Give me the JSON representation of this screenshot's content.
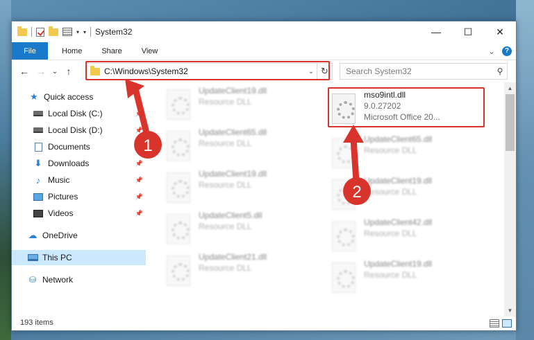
{
  "window": {
    "title": "System32",
    "controls": {
      "minimize": "—",
      "maximize": "☐",
      "close": "✕"
    }
  },
  "ribbon": {
    "tabs": [
      "File",
      "Home",
      "Share",
      "View"
    ],
    "expand_glyph": "⌄",
    "help_glyph": "?"
  },
  "nav": {
    "back": "←",
    "forward": "→",
    "recent": "⌄",
    "up": "↑",
    "address": "C:\\Windows\\System32",
    "address_dropdown": "⌄",
    "refresh": "↻",
    "search_placeholder": "Search System32",
    "search_glyph": "⚲"
  },
  "sidebar": {
    "items": [
      {
        "label": "Quick access",
        "icon": "star-icon"
      },
      {
        "label": "Local Disk (C:)",
        "icon": "drive-icon",
        "pinned": true
      },
      {
        "label": "Local Disk (D:)",
        "icon": "drive-icon",
        "pinned": true
      },
      {
        "label": "Documents",
        "icon": "documents-icon",
        "pinned": true
      },
      {
        "label": "Downloads",
        "icon": "downloads-icon",
        "pinned": true
      },
      {
        "label": "Music",
        "icon": "music-icon",
        "pinned": true
      },
      {
        "label": "Pictures",
        "icon": "pictures-icon",
        "pinned": true
      },
      {
        "label": "Videos",
        "icon": "videos-icon",
        "pinned": true
      },
      {
        "label": "OneDrive",
        "icon": "onedrive-icon"
      },
      {
        "label": "This PC",
        "icon": "this-pc-icon",
        "selected": true
      },
      {
        "label": "Network",
        "icon": "network-icon"
      }
    ],
    "pin_glyph": "📌"
  },
  "files": {
    "highlighted": {
      "name": "mso9intl.dll",
      "version": "9.0.27202",
      "description": "Microsoft Office 20..."
    },
    "left_column": [
      {
        "name": "UpdateClient19.dll",
        "type": "Resource DLL"
      },
      {
        "name": "UpdateClient65.dll",
        "type": "Resource DLL"
      },
      {
        "name": "UpdateClient19.dll",
        "type": "Resource DLL"
      },
      {
        "name": "UpdateClient5.dll",
        "type": "Resource DLL"
      },
      {
        "name": "UpdateClient21.dll",
        "type": "Resource DLL"
      }
    ],
    "right_column": [
      {
        "name": "UpdateClient65.dll",
        "type": "Resource DLL"
      },
      {
        "name": "UpdateClient19.dll",
        "type": "Resource DLL"
      },
      {
        "name": "UpdateClient42.dll",
        "type": "Resource DLL"
      },
      {
        "name": "UpdateClient19.dll",
        "type": "Resource DLL"
      }
    ]
  },
  "status": {
    "item_count": "193 items"
  },
  "annotations": {
    "step1": "1",
    "step2": "2",
    "color": "#d9342b"
  }
}
